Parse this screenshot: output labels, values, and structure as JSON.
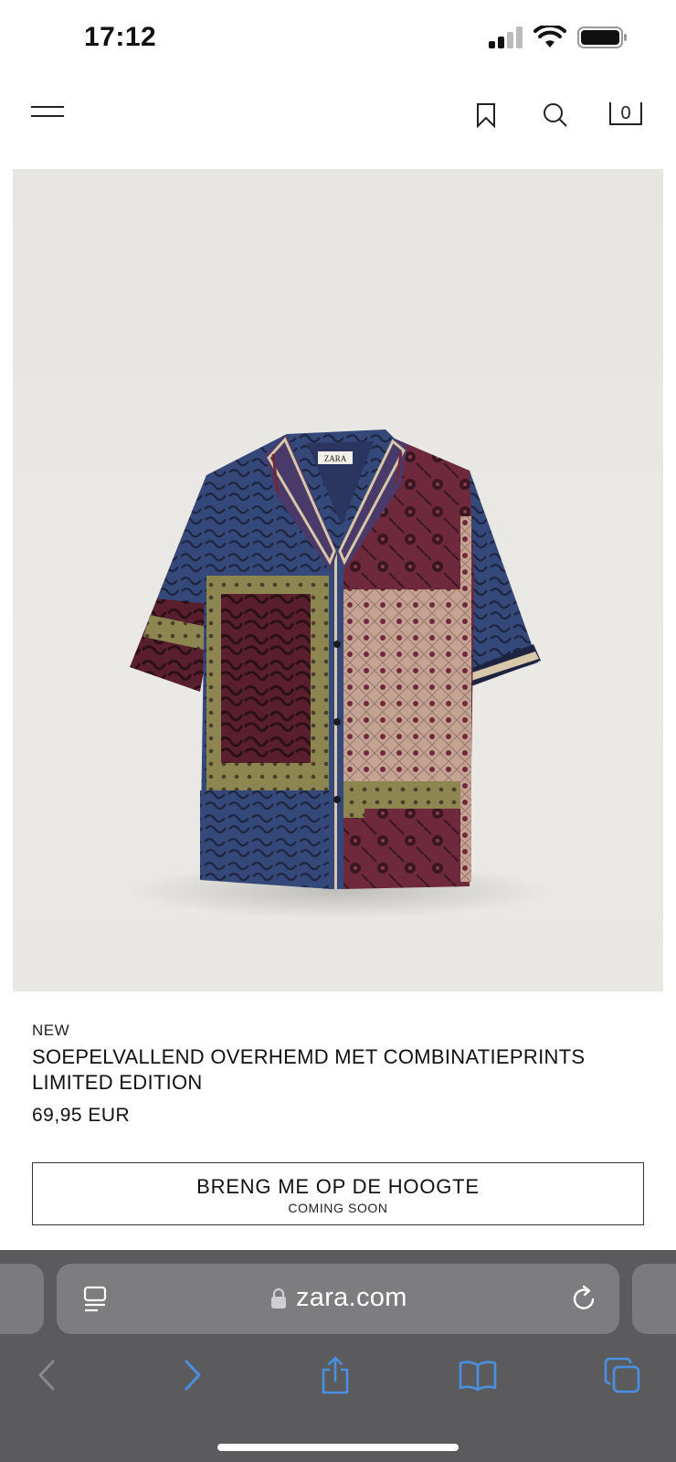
{
  "status_bar": {
    "time": "17:12"
  },
  "header": {
    "bag_count": "0"
  },
  "product": {
    "badge": "NEW",
    "title": "SOEPELVALLEND OVERHEMD MET COMBINATIEPRINTS LIMITED EDITION",
    "price": "69,95 EUR",
    "label_text": "ZARA"
  },
  "notify_button": {
    "label": "BRENG ME OP DE HOOGTE",
    "sublabel": "COMING SOON"
  },
  "browser": {
    "url": "zara.com"
  },
  "icons": {
    "menu": "menu-icon",
    "bookmark": "bookmark-icon",
    "search": "search-icon",
    "bag": "shopping-bag-icon",
    "reader": "reader-icon",
    "lock": "lock-icon",
    "reload": "reload-icon",
    "back": "back-icon",
    "forward": "forward-icon",
    "share": "share-icon",
    "bookmarks": "book-icon",
    "tabs": "tabs-icon"
  },
  "colors": {
    "accent_link": "#4a90e2",
    "safari_bar": "#5b5b5d",
    "shirt_navy": "#35487a",
    "shirt_burgundy": "#6e2a3c",
    "shirt_olive": "#8d8650",
    "shirt_blush": "#c5a393"
  }
}
